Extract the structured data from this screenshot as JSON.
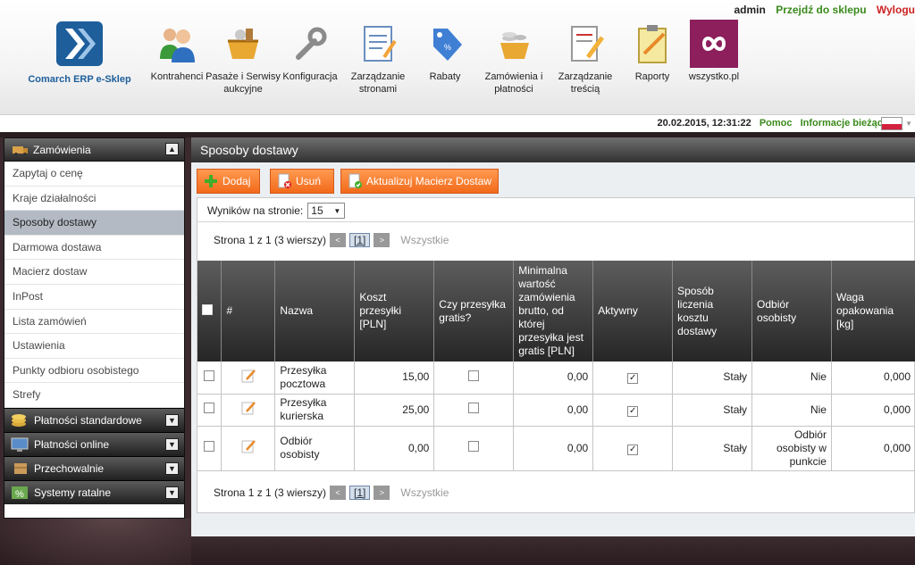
{
  "topbar": {
    "user": "admin",
    "shop_link": "Przejdź do sklepu",
    "logout_link": "Wylogu",
    "logo_text": "Comarch ERP e-Sklep",
    "nav": [
      {
        "label": "Kontrahenci",
        "icon": "users-icon"
      },
      {
        "label": "Pasaże i Serwisy aukcyjne",
        "icon": "auction-basket-icon"
      },
      {
        "label": "Konfiguracja",
        "icon": "wrench-icon"
      },
      {
        "label": "Zarządzanie stronami",
        "icon": "page-edit-icon"
      },
      {
        "label": "Rabaty",
        "icon": "discount-tag-icon"
      },
      {
        "label": "Zamówienia i płatności",
        "icon": "coins-basket-icon"
      },
      {
        "label": "Zarządzanie treścią",
        "icon": "content-edit-icon"
      },
      {
        "label": "Raporty",
        "icon": "clipboard-icon"
      },
      {
        "label": "wszystko.pl",
        "icon": "wszystko-logo-icon"
      }
    ]
  },
  "inforow": {
    "datetime": "20.02.2015, 12:31:22",
    "help": "Pomoc",
    "news": "Informacje bieżące",
    "flag": "pl-flag-icon"
  },
  "sidebar": {
    "section": {
      "label": "Zamówienia",
      "icon": "shipping-truck-icon",
      "toggle": "▲"
    },
    "items": [
      {
        "label": "Zapytaj o cenę"
      },
      {
        "label": "Kraje działalności"
      },
      {
        "label": "Sposoby dostawy",
        "active": true
      },
      {
        "label": "Darmowa dostawa"
      },
      {
        "label": "Macierz dostaw"
      },
      {
        "label": "InPost"
      },
      {
        "label": "Lista zamówień"
      },
      {
        "label": "Ustawienia"
      },
      {
        "label": "Punkty odbioru osobistego"
      },
      {
        "label": "Strefy"
      }
    ],
    "collapsed": [
      {
        "label": "Płatności standardowe",
        "icon": "coins-icon",
        "toggle": "▼"
      },
      {
        "label": "Płatności online",
        "icon": "online-payment-icon",
        "toggle": "▼"
      },
      {
        "label": "Przechowalnie",
        "icon": "box-icon",
        "toggle": "▼"
      },
      {
        "label": "Systemy ratalne",
        "icon": "percent-icon",
        "toggle": "▼"
      }
    ]
  },
  "main": {
    "title": "Sposoby dostawy",
    "toolbar": {
      "add": "Dodaj",
      "delete": "Usuń",
      "update": "Aktualizuj Macierz Dostaw"
    },
    "per_page_label": "Wyników na stronie:",
    "per_page_value": "15",
    "pager": {
      "info": "Strona 1 z 1 (3 wierszy)",
      "prev": "<",
      "page": "[1]",
      "next": ">",
      "all": "Wszystkie"
    },
    "table": {
      "headers": {
        "hash": "#",
        "name": "Nazwa",
        "cost": "Koszt przesyłki [PLN]",
        "free": "Czy przesyłka gratis?",
        "min": "Minimalna wartość zamówienia brutto, od której przesyłka jest gratis [PLN]",
        "active": "Aktywny",
        "method": "Sposób liczenia kosztu dostawy",
        "pickup": "Odbiór osobisty",
        "weight": "Waga opakowania [kg]"
      },
      "rows": [
        {
          "name": "Przesyłka pocztowa",
          "cost": "15,00",
          "free": false,
          "min": "0,00",
          "active": true,
          "method": "Stały",
          "pickup": "Nie",
          "weight": "0,000"
        },
        {
          "name": "Przesyłka kurierska",
          "cost": "25,00",
          "free": false,
          "min": "0,00",
          "active": true,
          "method": "Stały",
          "pickup": "Nie",
          "weight": "0,000"
        },
        {
          "name": "Odbiór osobisty",
          "cost": "0,00",
          "free": false,
          "min": "0,00",
          "active": true,
          "method": "Stały",
          "pickup": "Odbiór osobisty w punkcie",
          "weight": "0,000"
        }
      ]
    }
  },
  "colors": {
    "orange_button": "#f26a1a",
    "link_green": "#3a8a1c",
    "logout_red": "#cc2222",
    "brand_blue": "#1d5e9b",
    "wszystko_purple": "#8c1f5c"
  }
}
